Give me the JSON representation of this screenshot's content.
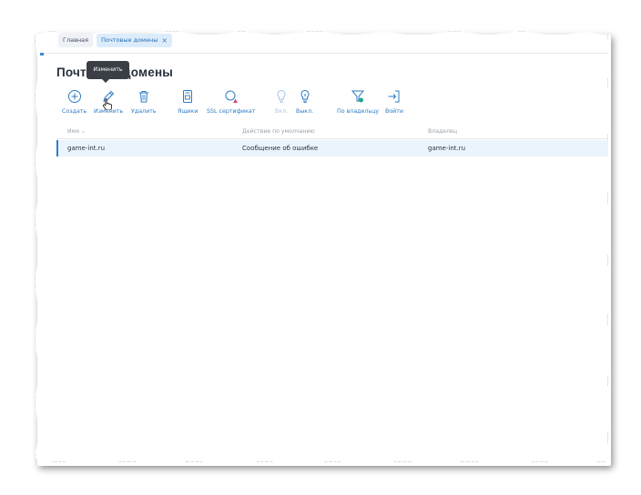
{
  "tabs": [
    {
      "label": "Главная"
    },
    {
      "label": "Почтовые домены",
      "close": "×"
    }
  ],
  "page_title": "Почтовые домены",
  "tooltip": "Изменить",
  "toolbar": {
    "create": "Создать",
    "edit": "Изменить",
    "delete": "Удалить",
    "mailboxes": "Ящики",
    "ssl": "SSL сертификат",
    "on": "Вкл.",
    "off": "Выкл.",
    "by_owner": "По владельцу",
    "login": "Войти"
  },
  "table": {
    "headers": {
      "name": "Имя",
      "default_action": "Действие по умолчанию",
      "owner": "Владелец"
    },
    "sort_indicator": "⌄",
    "rows": [
      {
        "name": "game-int.ru",
        "default_action": "Сообщение об ошибке",
        "owner": "game-int.ru"
      }
    ]
  },
  "colors": {
    "accent": "#2e7bc4",
    "selected_row": "#eaf4fc",
    "tooltip_bg": "#3a3f45",
    "ssl_warning": "#d64a7a",
    "filter_green": "#1fa78a"
  }
}
